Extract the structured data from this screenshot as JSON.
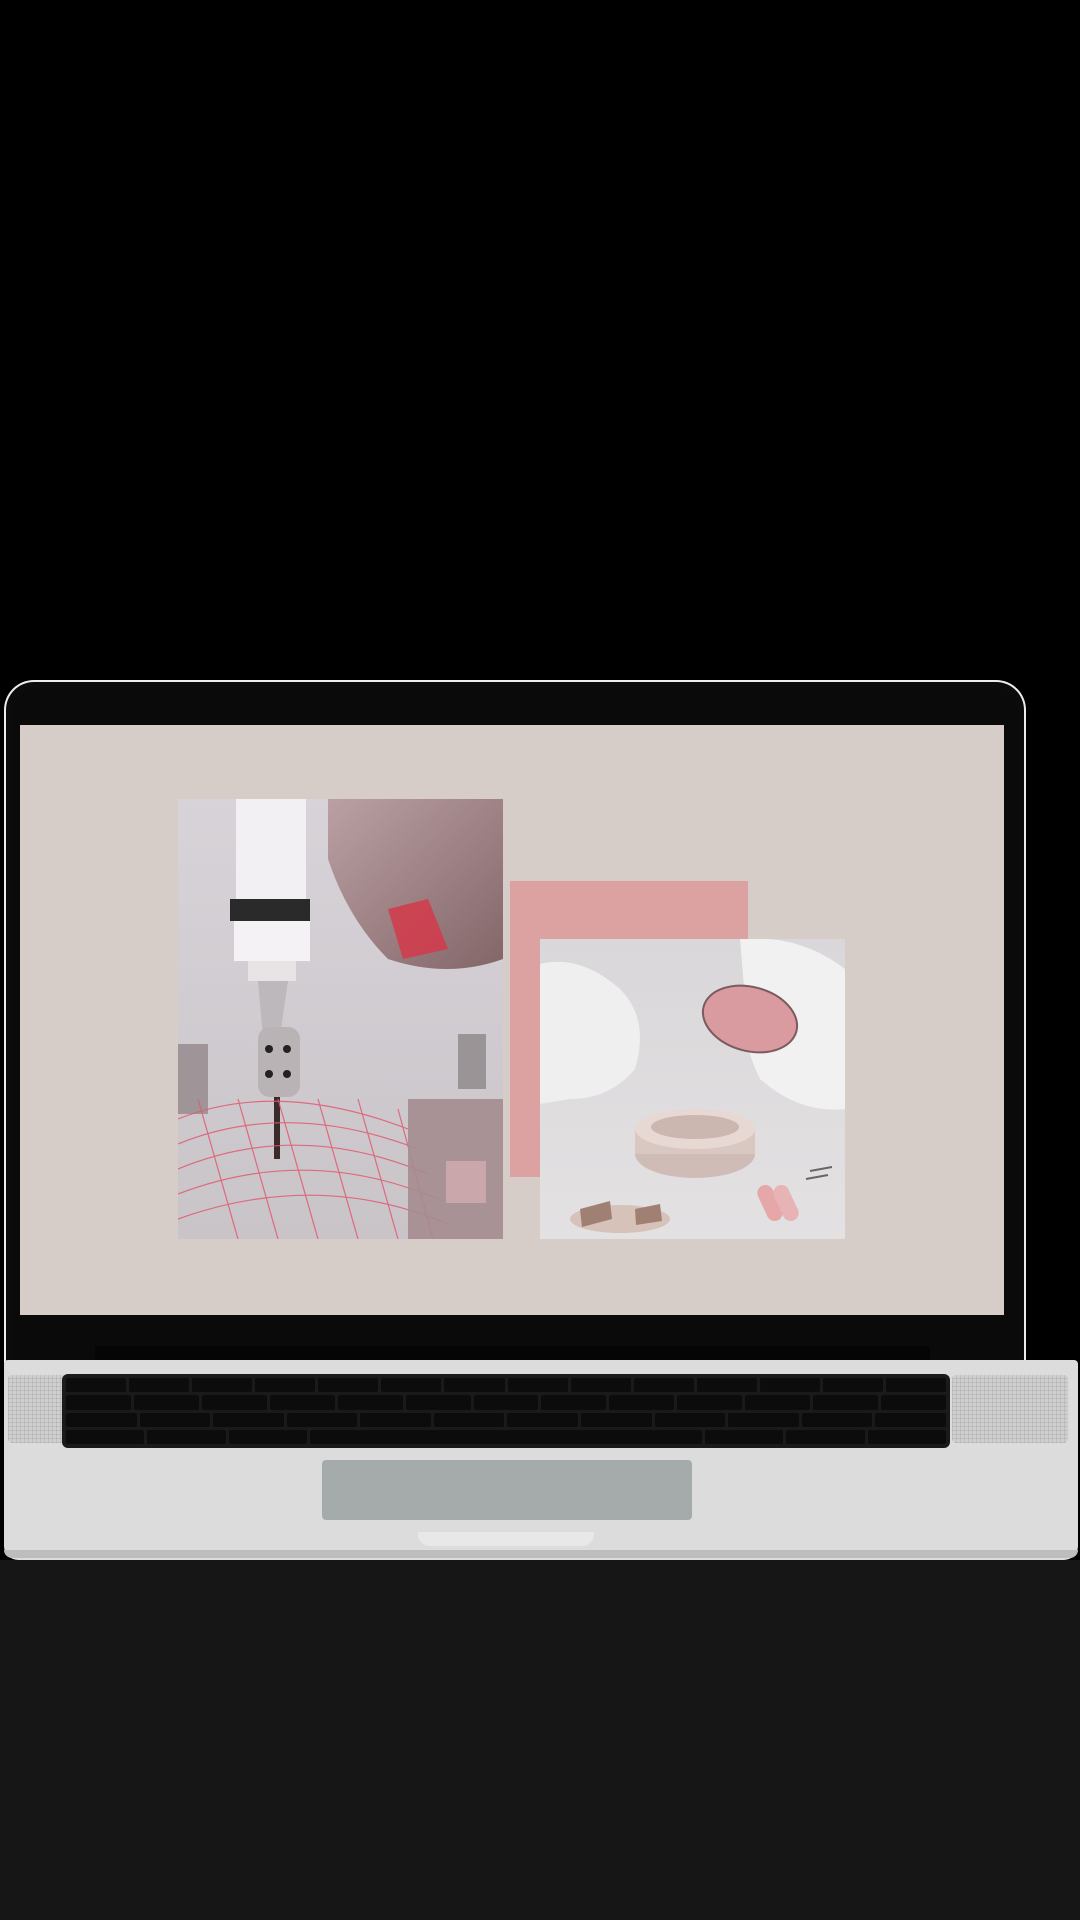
{
  "scene": {
    "device": "laptop",
    "screen_content": "photo-collage"
  },
  "colors": {
    "background_top": "#000000",
    "background_bottom": "#161616",
    "screen_bg": "#d6cdc9",
    "accent_pink": "#dca2a2",
    "laptop_silver": "#dcdcdc",
    "trackpad": "#a5abab"
  },
  "photos": [
    {
      "name": "robotic-arm-photo"
    },
    {
      "name": "optical-components-photo"
    }
  ]
}
